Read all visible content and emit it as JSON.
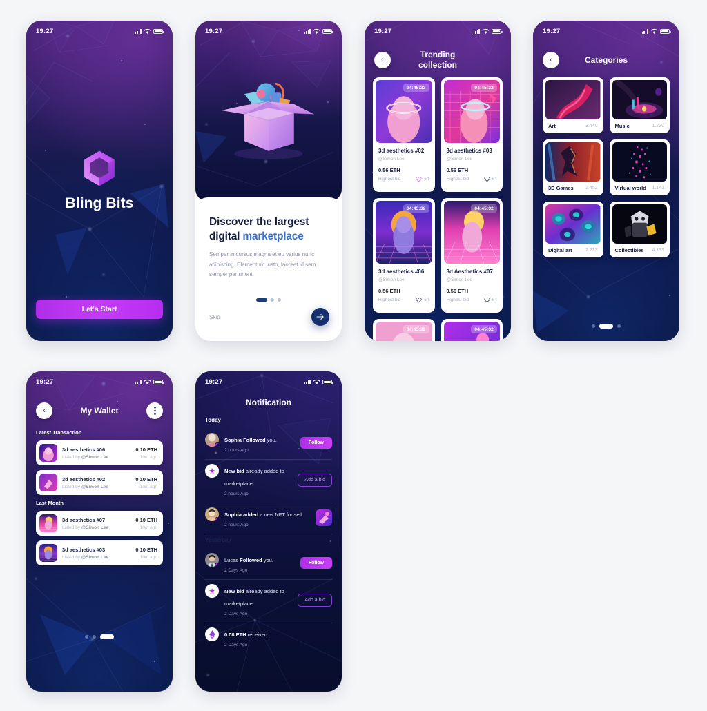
{
  "status_bar": {
    "time": "19:27",
    "signal_icon": "cellular-signal-icon",
    "wifi_icon": "wifi-icon",
    "battery_icon": "battery-icon"
  },
  "screens": {
    "splash": {
      "name": "splash-screen",
      "app_title": "Bling Bits",
      "logo_icon": "hexagon-logo-icon",
      "cta_label": "Let's Start"
    },
    "onboarding": {
      "name": "onboarding-screen",
      "illustration": "open-box-illustration",
      "heading_line1": "Discover the largest",
      "heading_line2_plain": "digital ",
      "heading_line2_accent": "marketplace",
      "body": "Semper in cursus magna et eu varius nunc adipiscing. Elementum justo, laoreet id sem semper parturient.",
      "skip_label": "Skip",
      "next_icon": "arrow-right-icon",
      "dots": {
        "count": 3,
        "active_index": 0
      }
    },
    "trending": {
      "name": "trending-collection-screen",
      "back_icon": "chevron-left-icon",
      "title_line1": "Trending",
      "title_line2": "collection",
      "cards": [
        {
          "name": "3d aesthetics #02",
          "owner": "@Simon Lee",
          "price": "0.56 ETH",
          "bid_label": "Highest bid",
          "likes": "64",
          "timer": "04:45:32",
          "liked": true
        },
        {
          "name": "3d aesthetics #03",
          "owner": "@Simon Lee",
          "price": "0.56 ETH",
          "bid_label": "Highest bid",
          "likes": "64",
          "timer": "04:45:32",
          "liked": false
        },
        {
          "name": "3d aesthetics #06",
          "owner": "@Simon Lee",
          "price": "0.56 ETH",
          "bid_label": "Highest bid",
          "likes": "64",
          "timer": "04:45:32",
          "liked": false
        },
        {
          "name": "3d Aesthetics #07",
          "owner": "@Simon Lee",
          "price": "0.56 ETH",
          "bid_label": "Highest bid",
          "likes": "64",
          "timer": "04:45:32",
          "liked": false
        },
        {
          "name": "",
          "owner": "",
          "price": "",
          "bid_label": "",
          "likes": "",
          "timer": "04:45:32",
          "liked": false
        },
        {
          "name": "",
          "owner": "",
          "price": "",
          "bid_label": "",
          "likes": "",
          "timer": "04:45:32",
          "liked": false
        }
      ]
    },
    "categories": {
      "name": "categories-screen",
      "back_icon": "chevron-left-icon",
      "title": "Categories",
      "items": [
        {
          "label": "Art",
          "count": "3.440"
        },
        {
          "label": "Music",
          "count": "1.230"
        },
        {
          "label": "3D Games",
          "count": "2.452"
        },
        {
          "label": "Virtual world",
          "count": "1.141"
        },
        {
          "label": "Digital art",
          "count": "2.213"
        },
        {
          "label": "Collectibles",
          "count": "4.133"
        }
      ],
      "pager": {
        "count": 3,
        "active_index": 1
      }
    },
    "wallet": {
      "name": "my-wallet-screen",
      "back_icon": "chevron-left-icon",
      "title": "My Wallet",
      "menu_icon": "more-vertical-icon",
      "groups": [
        {
          "label": "Latest Transaction",
          "rows": [
            {
              "name": "3d aesthetics #06",
              "listed_prefix": "Listed by ",
              "listed_by": "@Simon Lee",
              "amount": "0.10 ETH",
              "ago": "10m ago"
            },
            {
              "name": "3d aesthetics #02",
              "listed_prefix": "Listed by ",
              "listed_by": "@Simon Lee",
              "amount": "0.10 ETH",
              "ago": "10m ago"
            }
          ]
        },
        {
          "label": "Last Month",
          "rows": [
            {
              "name": "3d aesthetics #07",
              "listed_prefix": "Listed by ",
              "listed_by": "@Simon Lee",
              "amount": "0.10 ETH",
              "ago": "10m ago"
            },
            {
              "name": "3d aesthetics #03",
              "listed_prefix": "Listed by ",
              "listed_by": "@Simon Lee",
              "amount": "0.10 ETH",
              "ago": "10m ago"
            }
          ]
        }
      ],
      "pager": {
        "count": 3,
        "active_index": 2
      }
    },
    "notification": {
      "name": "notification-screen",
      "title": "Notification",
      "group_today": "Today",
      "group_yesterday": "Yesterday",
      "items": [
        {
          "icon": "avatar",
          "bold": "Sophia Followed",
          "rest": " you.",
          "time": "2 hours Ago",
          "action": "Follow",
          "action_style": "filled"
        },
        {
          "icon": "star-icon",
          "bold": "New bid",
          "rest": " already added to marketplace.",
          "time": "2 hours Ago",
          "action": "Add a bid",
          "action_style": "outline"
        },
        {
          "icon": "avatar",
          "bold": "Sophia  added",
          "rest": " a new NFT for sell.",
          "time": "2 hours Ago",
          "action": "thumb",
          "action_style": "thumbnail"
        },
        {
          "icon": "avatar",
          "bold_pre": "Lucas ",
          "bold": "Followed",
          "rest": " you.",
          "time": "2 Days Ago",
          "action": "Follow",
          "action_style": "filled"
        },
        {
          "icon": "star-icon",
          "bold": "New bid",
          "rest": " already added to marketplace.",
          "time": "2 Days Ago",
          "action": "Add a bid",
          "action_style": "outline"
        },
        {
          "icon": "ethereum-icon",
          "bold": "0.08 ETH",
          "rest": " received.",
          "time": "2 Days Ago",
          "action": "",
          "action_style": "none"
        }
      ]
    }
  },
  "colors": {
    "brand_purple": "#b02ee8",
    "deep_navy": "#0d1340",
    "accent_blue": "#3d72c9",
    "card_white": "#ffffff"
  }
}
